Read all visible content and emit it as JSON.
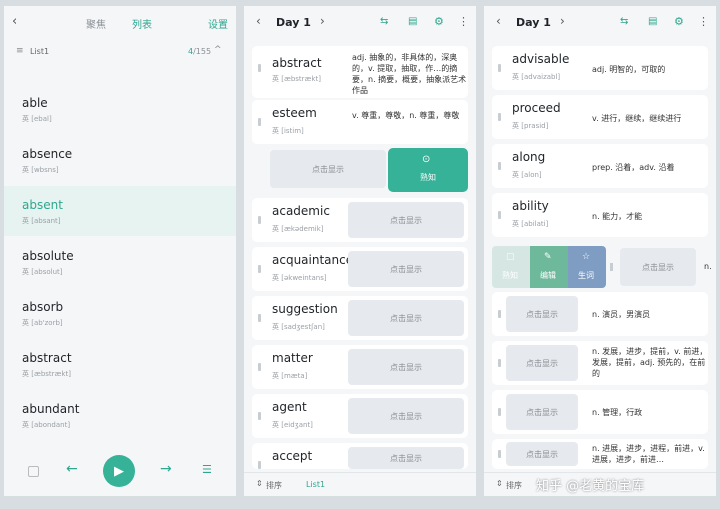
{
  "panel1": {
    "tabs": [
      "聚焦",
      "列表"
    ],
    "settings": "设置",
    "list_name": "List1",
    "count": "4",
    "total": "/155",
    "words": [
      {
        "w": "able",
        "p": "英 [ebal]"
      },
      {
        "w": "absence",
        "p": "英 [wbsns]"
      },
      {
        "w": "absent",
        "p": "英 [absant]"
      },
      {
        "w": "absolute",
        "p": "英 [absolut]"
      },
      {
        "w": "absorb",
        "p": "英 [ab'zorb]"
      },
      {
        "w": "abstract",
        "p": "英 [æbstrækt]"
      },
      {
        "w": "abundant",
        "p": "英 [abondant]"
      }
    ]
  },
  "panel2": {
    "title": "Day 1",
    "rows": [
      {
        "w": "abstract",
        "p": "英 [æbstrækt]",
        "m": "adj. 抽象的，非具体的，深奥的，v. 提取，抽取，作…的摘要，n. 摘要，概要，抽象派艺术作品"
      },
      {
        "w": "esteem",
        "p": "英 [istim]",
        "m": "v. 尊重，尊敬，n. 尊重，尊敬"
      }
    ],
    "swipe_reveal": "点击显示",
    "swipe_known": "熟知",
    "rows2": [
      {
        "w": "academic",
        "p": "英 [ækədemik]"
      },
      {
        "w": "acquaintance",
        "p": "英 [əkweintans]"
      },
      {
        "w": "suggestion",
        "p": "英 [sadʒestʃan]"
      },
      {
        "w": "matter",
        "p": "英 [mæta]"
      },
      {
        "w": "agent",
        "p": "英 [eidʒant]"
      },
      {
        "w": "accept",
        "p": "英 [əksept]"
      }
    ],
    "reveal": "点击显示",
    "sort": "排序",
    "list": "List1"
  },
  "panel3": {
    "title": "Day 1",
    "rows": [
      {
        "w": "advisable",
        "p": "英 [advaizabl]",
        "m": "adj. 明智的，可取的"
      },
      {
        "w": "proceed",
        "p": "英 [prasid]",
        "m": "v. 进行，继续，继续进行"
      },
      {
        "w": "along",
        "p": "英 [alon]",
        "m": "prep. 沿着，adv. 沿着"
      },
      {
        "w": "ability",
        "p": "英 [abilati]",
        "m": "n. 能力，才能"
      }
    ],
    "swipe_buttons": [
      "熟知",
      "编辑",
      "生词"
    ],
    "swipe_reveal": "点击显示",
    "swipe_tail": "n.",
    "rows2": [
      {
        "m": "n. 演员，男演员"
      },
      {
        "m": "n. 发展，进步，提前，v. 前进，发展，提前，adj. 预先的，在前的"
      },
      {
        "m": "n. 管理，行政"
      },
      {
        "m": "n. 进展，进步，进程，前进，v. 进展，进步，前进…"
      }
    ],
    "reveal": "点击显示",
    "sort": "排序",
    "watermark": "知乎 @老黄的宝库"
  }
}
